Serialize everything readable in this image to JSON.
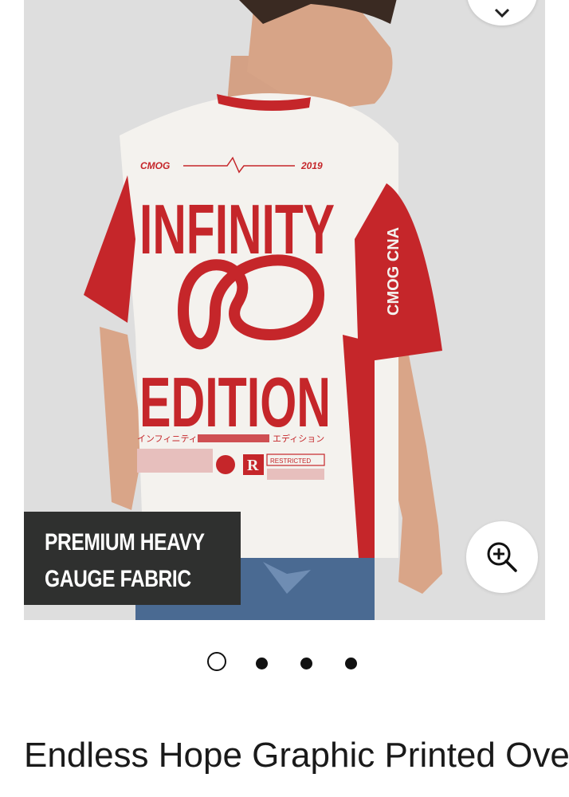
{
  "product": {
    "badge": {
      "line1": "PREMIUM HEAVY",
      "line2": "GAUGE FABRIC"
    },
    "title": "Endless Hope Graphic Printed Oversized T-Shirts Multi Color",
    "shirt_print": {
      "top_left": "CMOG",
      "top_right": "2019",
      "headline1": "INFINITY",
      "headline2": "EDITION",
      "japanese": "インフィニティ",
      "japanese_right": "エディション",
      "restricted": "RESTRICTED",
      "r_mark": "R",
      "sleeve": "CMOG CNA"
    }
  },
  "carousel": {
    "count": 4,
    "active_index": 0
  },
  "icons": {
    "wishlist": "heart-icon",
    "zoom": "zoom-in-icon"
  },
  "colors": {
    "shirt_red": "#c5262a",
    "shirt_white": "#f4f2ee",
    "badge_bg": "#2f302f"
  }
}
